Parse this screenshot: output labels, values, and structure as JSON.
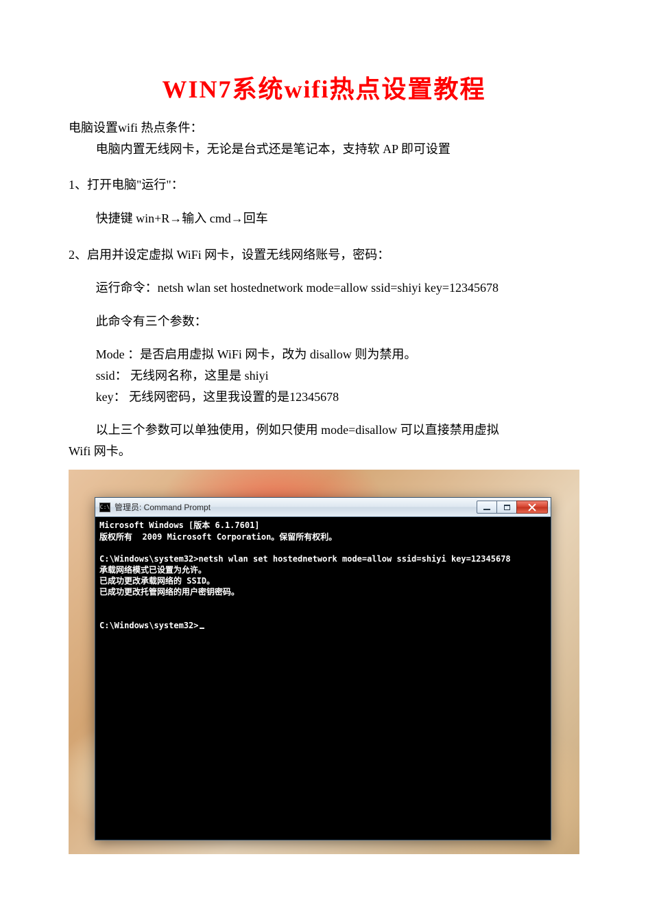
{
  "title": "WIN7系统wifi热点设置教程",
  "cond_header": "电脑设置wifi 热点条件：",
  "cond_body": "电脑内置无线网卡，无论是台式还是笔记本，支持软 AP 即可设置",
  "step1_header": "1、打开电脑\"运行\"：",
  "step1_body": "快捷键 win+R→输入 cmd→回车",
  "step2_header": "2、启用并设定虚拟 WiFi 网卡，设置无线网络账号，密码：",
  "step2_cmd": "运行命令：netsh wlan set hostednetwork mode=allow ssid=shiyi key=12345678",
  "params_intro": "此命令有三个参数：",
  "param_mode": "Mode ：是否启用虚拟 WiFi 网卡，改为 disallow 则为禁用。",
  "param_ssid": "ssid：  无线网名称，这里是 shiyi",
  "param_key": "key：  无线网密码，这里我设置的是12345678",
  "note_line1": "以上三个参数可以单独使用，例如只使用 mode=disallow 可以直接禁用虚拟",
  "note_line2": "Wifi 网卡。",
  "cmd": {
    "title": "管理员: Command Prompt",
    "lines": [
      "Microsoft Windows [版本 6.1.7601]",
      "版权所有 <c> 2009 Microsoft Corporation。保留所有权利。",
      "",
      "C:\\Windows\\system32>netsh wlan set hostednetwork mode=allow ssid=shiyi key=12345678",
      "承载网络模式已设置为允许。",
      "已成功更改承载网络的 SSID。",
      "已成功更改托管网络的用户密钥密码。",
      "",
      "",
      "C:\\Windows\\system32>"
    ]
  }
}
